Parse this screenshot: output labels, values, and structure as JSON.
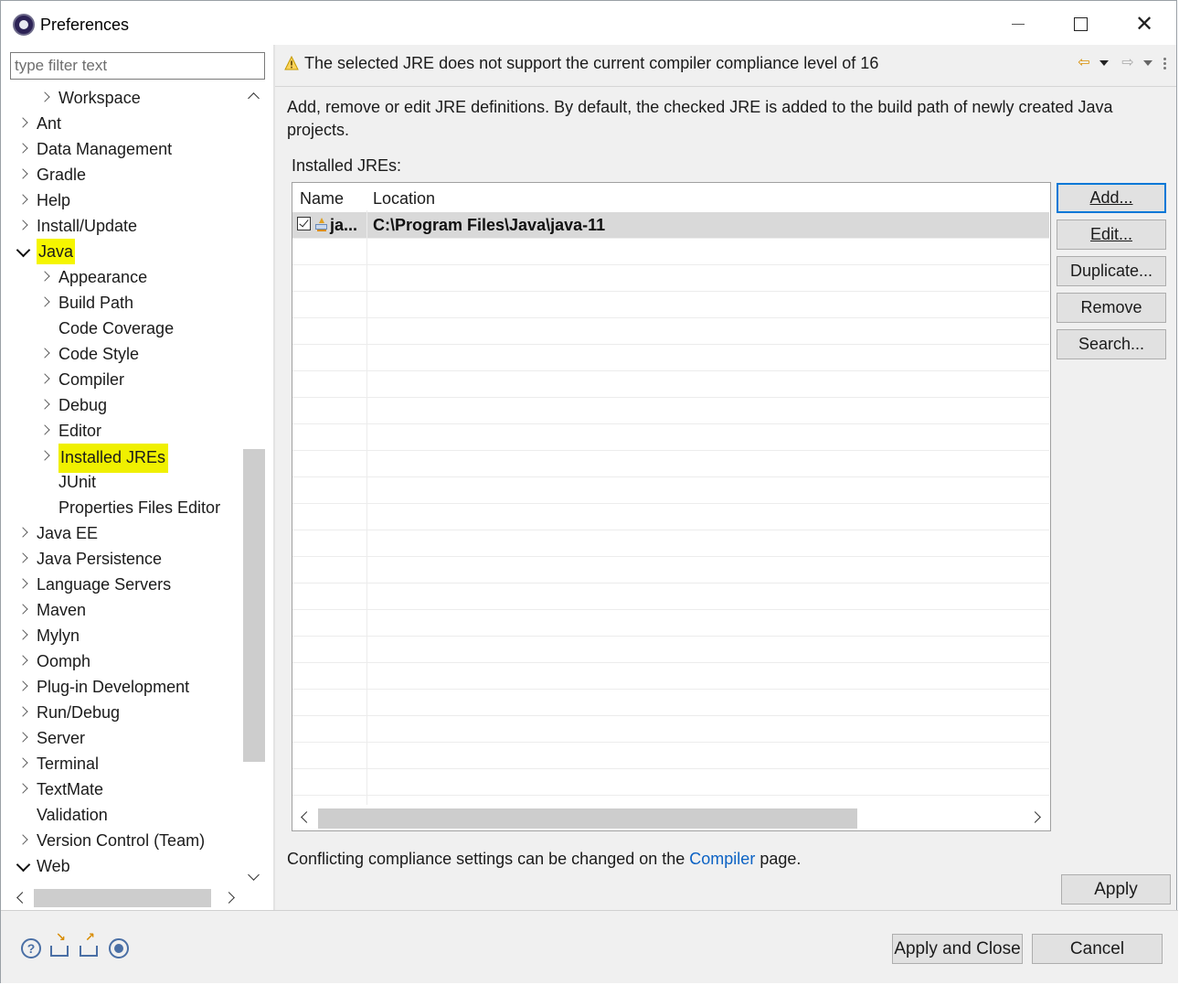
{
  "window": {
    "title": "Preferences"
  },
  "left": {
    "filter_placeholder": "type filter text",
    "tree": [
      {
        "label": "Workspace",
        "level": 1,
        "arrow": "right"
      },
      {
        "label": "Ant",
        "level": 0,
        "arrow": "right"
      },
      {
        "label": "Data Management",
        "level": 0,
        "arrow": "right"
      },
      {
        "label": "Gradle",
        "level": 0,
        "arrow": "right"
      },
      {
        "label": "Help",
        "level": 0,
        "arrow": "right"
      },
      {
        "label": "Install/Update",
        "level": 0,
        "arrow": "right"
      },
      {
        "label": "Java",
        "level": 0,
        "arrow": "down",
        "highlight": true
      },
      {
        "label": "Appearance",
        "level": 1,
        "arrow": "right"
      },
      {
        "label": "Build Path",
        "level": 1,
        "arrow": "right"
      },
      {
        "label": "Code Coverage",
        "level": 1,
        "arrow": "none"
      },
      {
        "label": "Code Style",
        "level": 1,
        "arrow": "right"
      },
      {
        "label": "Compiler",
        "level": 1,
        "arrow": "right"
      },
      {
        "label": "Debug",
        "level": 1,
        "arrow": "right"
      },
      {
        "label": "Editor",
        "level": 1,
        "arrow": "right"
      },
      {
        "label": "Installed JREs",
        "level": 1,
        "arrow": "right",
        "highlight": true,
        "selected": true
      },
      {
        "label": "JUnit",
        "level": 1,
        "arrow": "none"
      },
      {
        "label": "Properties Files Editor",
        "level": 1,
        "arrow": "none"
      },
      {
        "label": "Java EE",
        "level": 0,
        "arrow": "right"
      },
      {
        "label": "Java Persistence",
        "level": 0,
        "arrow": "right"
      },
      {
        "label": "Language Servers",
        "level": 0,
        "arrow": "right"
      },
      {
        "label": "Maven",
        "level": 0,
        "arrow": "right"
      },
      {
        "label": "Mylyn",
        "level": 0,
        "arrow": "right"
      },
      {
        "label": "Oomph",
        "level": 0,
        "arrow": "right"
      },
      {
        "label": "Plug-in Development",
        "level": 0,
        "arrow": "right"
      },
      {
        "label": "Run/Debug",
        "level": 0,
        "arrow": "right"
      },
      {
        "label": "Server",
        "level": 0,
        "arrow": "right"
      },
      {
        "label": "Terminal",
        "level": 0,
        "arrow": "right"
      },
      {
        "label": "TextMate",
        "level": 0,
        "arrow": "right"
      },
      {
        "label": "Validation",
        "level": 0,
        "arrow": "none"
      },
      {
        "label": "Version Control (Team)",
        "level": 0,
        "arrow": "right"
      },
      {
        "label": "Web",
        "level": 0,
        "arrow": "down"
      }
    ]
  },
  "right": {
    "message": "The selected JRE does not support the current compiler compliance level of 16",
    "description": "Add, remove or edit JRE definitions. By default, the checked JRE is added to the build path of newly created Java projects.",
    "installed_label": "Installed JREs:",
    "table": {
      "columns": [
        "Name",
        "Location"
      ],
      "rows": [
        {
          "name": "ja...",
          "location": "C:\\Program Files\\Java\\java-11",
          "checked": true
        }
      ]
    },
    "buttons": {
      "add": "Add...",
      "edit": "Edit...",
      "duplicate": "Duplicate...",
      "remove": "Remove",
      "search": "Search..."
    },
    "conflict_prefix": "Conflicting compliance settings can be changed on the",
    "conflict_link": "Compiler",
    "conflict_suffix": "page.",
    "apply": "Apply"
  },
  "footer": {
    "apply_close": "Apply and Close",
    "cancel": "Cancel"
  },
  "colors": {
    "highlight": "#f5f500",
    "link": "#0b62c4",
    "default_button_border": "#0078d7"
  }
}
